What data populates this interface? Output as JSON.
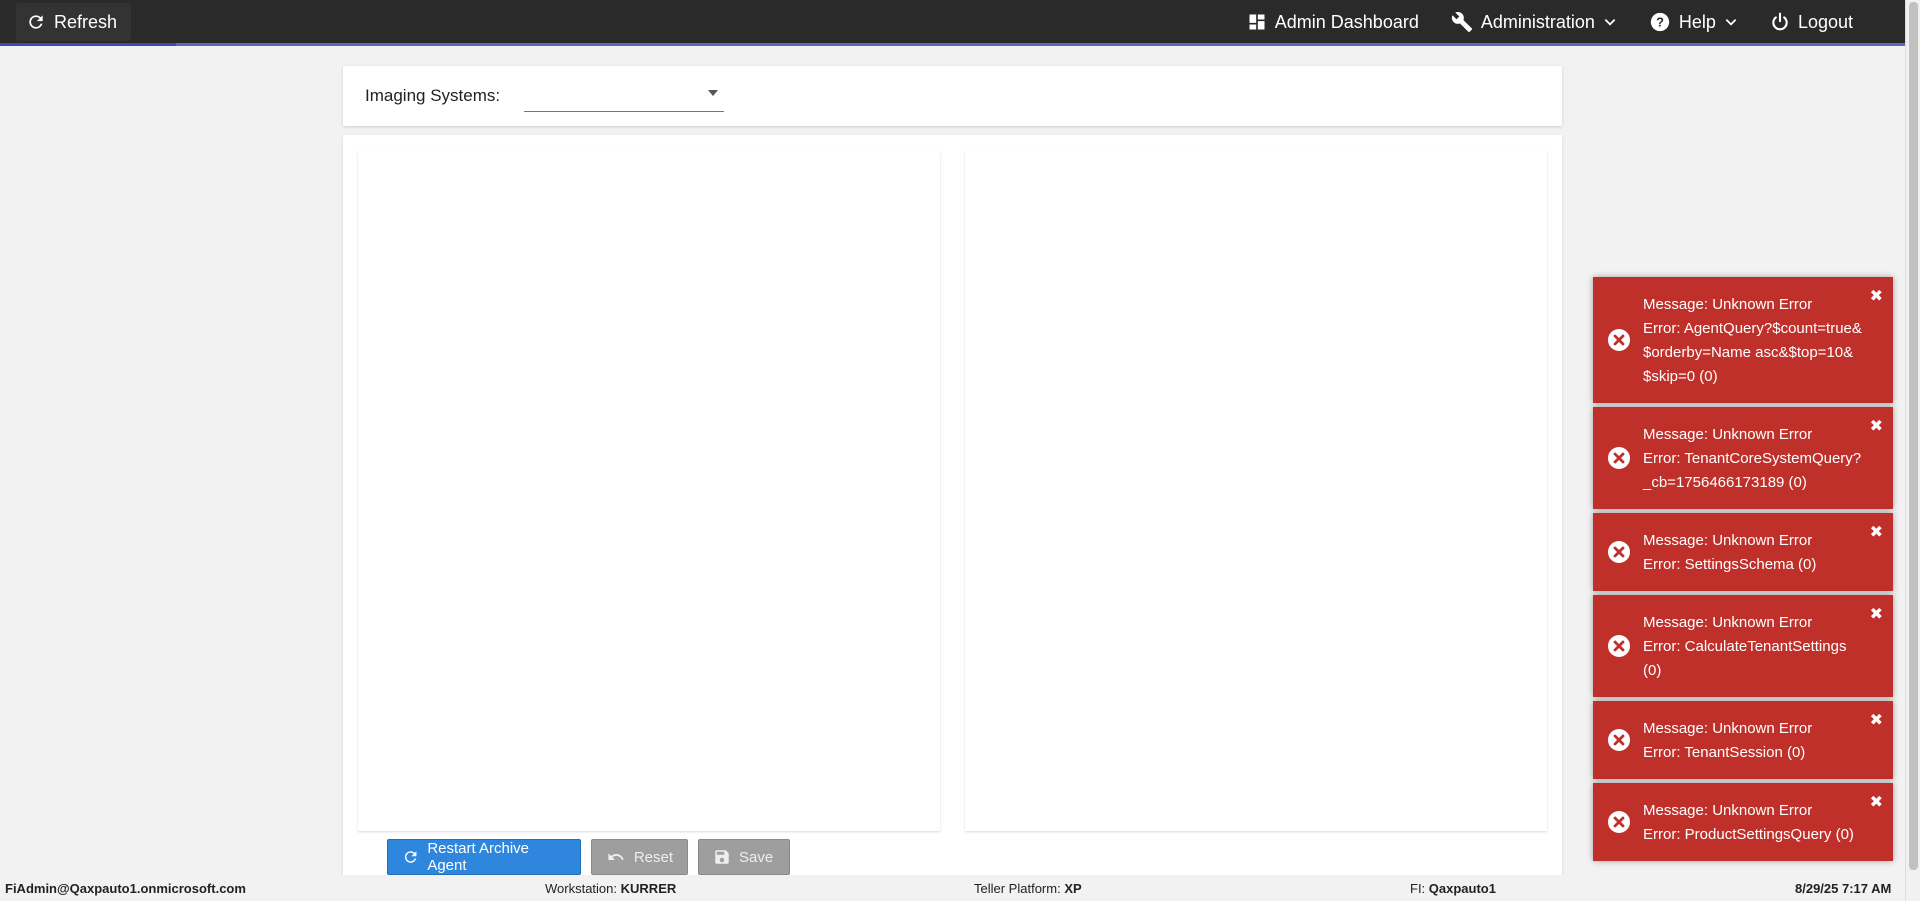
{
  "topbar": {
    "refresh_label": "Refresh",
    "nav": {
      "admin_dashboard": "Admin Dashboard",
      "administration": "Administration",
      "help": "Help",
      "logout": "Logout"
    }
  },
  "filter": {
    "label": "Imaging Systems:",
    "selected": ""
  },
  "actions": {
    "restart": "Restart Archive Agent",
    "reset": "Reset",
    "save": "Save"
  },
  "statusbar": {
    "user": "FiAdmin@Qaxpauto1.onmicrosoft.com",
    "workstation_label": "Workstation:",
    "workstation": "KURRER",
    "platform_label": "Teller Platform:",
    "platform": "XP",
    "fi_label": "FI:",
    "fi": "Qaxpauto1",
    "datetime": "8/29/25 7:17 AM"
  },
  "toasts": [
    {
      "line1": "Message: Unknown Error",
      "line2": "Error: AgentQuery?$count=true&$orderby=Name asc&$top=10&$skip=0 (0)"
    },
    {
      "line1": "Message: Unknown Error",
      "line2": "Error: TenantCoreSystemQuery?_cb=1756466173189 (0)"
    },
    {
      "line1": "Message: Unknown Error",
      "line2": "Error: SettingsSchema (0)"
    },
    {
      "line1": "Message: Unknown Error",
      "line2": "Error: CalculateTenantSettings (0)"
    },
    {
      "line1": "Message: Unknown Error",
      "line2": "Error: TenantSession (0)"
    },
    {
      "line1": "Message: Unknown Error",
      "line2": "Error: ProductSettingsQuery (0)"
    }
  ],
  "colors": {
    "topbar": "#2a2a2a",
    "toast": "#c0302b",
    "primary": "#2f87dd"
  }
}
